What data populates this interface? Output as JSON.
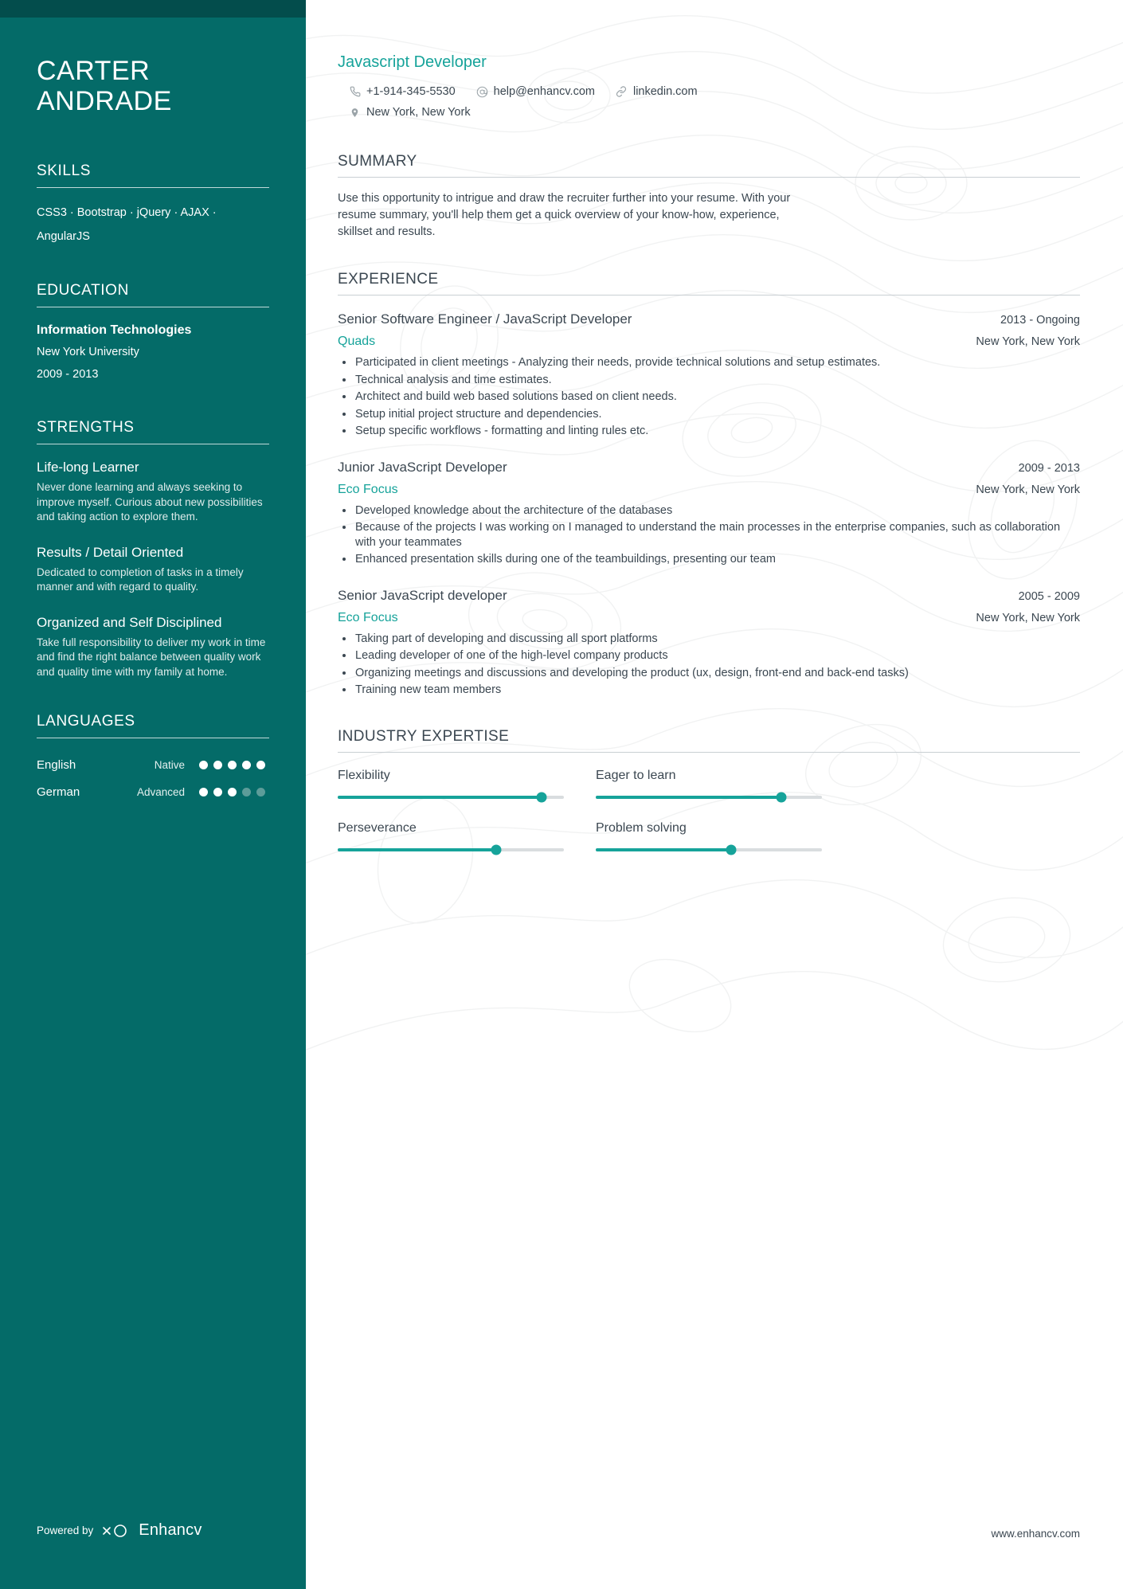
{
  "theme": {
    "sidebar_bg": "#046b68",
    "sidebar_strip": "#034d4c",
    "accent": "#16a39a",
    "text_dark": "#3b4751"
  },
  "sidebar": {
    "name_first": "CARTER",
    "name_last": "ANDRADE",
    "skills": {
      "heading": "SKILLS",
      "text": "CSS3 · Bootstrap · jQuery · AJAX · AngularJS"
    },
    "education": {
      "heading": "EDUCATION",
      "degree": "Information Technologies",
      "school": "New York University",
      "dates": "2009 - 2013"
    },
    "strengths": {
      "heading": "STRENGTHS",
      "items": [
        {
          "title": "Life-long Learner",
          "desc": "Never done learning and always seeking to improve myself. Curious about new possibilities and taking action to explore them."
        },
        {
          "title": "Results / Detail Oriented",
          "desc": "Dedicated to completion of tasks in a timely manner and with regard to quality."
        },
        {
          "title": "Organized and Self Disciplined",
          "desc": "Take full responsibility to deliver my work in time and find the right balance between quality work and quality time with my family at home."
        }
      ]
    },
    "languages": {
      "heading": "LANGUAGES",
      "items": [
        {
          "name": "English",
          "level": "Native",
          "filled": 5,
          "total": 5
        },
        {
          "name": "German",
          "level": "Advanced",
          "filled": 3,
          "total": 5
        }
      ]
    },
    "footer": {
      "powered_by": "Powered by",
      "brand": "Enhancv"
    }
  },
  "main": {
    "role_title": "Javascript Developer",
    "contacts": [
      {
        "icon": "phone-icon",
        "text": "+1-914-345-5530"
      },
      {
        "icon": "email-icon",
        "text": "help@enhancv.com"
      },
      {
        "icon": "link-icon",
        "text": "linkedin.com"
      },
      {
        "icon": "location-icon",
        "text": "New York, New York"
      }
    ],
    "summary": {
      "heading": "SUMMARY",
      "text": "Use this opportunity to intrigue and draw the recruiter further into your resume. With your resume summary, you'll help them get a quick overview of your know-how, experience, skillset and results."
    },
    "experience": {
      "heading": "EXPERIENCE",
      "jobs": [
        {
          "title": "Senior Software Engineer / JavaScript Developer",
          "dates": "2013 - Ongoing",
          "company": "Quads",
          "location": "New York, New York",
          "bullets": [
            "Participated in client meetings - Analyzing their needs, provide technical solutions and setup estimates.",
            "Technical analysis and time estimates.",
            "Architect and build web based solutions based on client needs.",
            "Setup initial project structure and dependencies.",
            "Setup specific workflows - formatting and linting rules etc."
          ]
        },
        {
          "title": "Junior JavaScript Developer",
          "dates": "2009 - 2013",
          "company": "Eco Focus",
          "location": "New York, New York",
          "bullets": [
            "Developed knowledge about the architecture of the databases",
            "Because of the projects I was working on I managed to understand  the main processes in the enterprise companies, such as collaboration  with your teammates",
            "Enhanced presentation skills during one of the teambuildings, presenting our team"
          ]
        },
        {
          "title": "Senior JavaScript developer",
          "dates": "2005 - 2009",
          "company": "Eco Focus",
          "location": "New York, New York",
          "bullets": [
            "Taking part of developing and discussing all sport platforms",
            "Leading developer of one of the high-level company products",
            "Organizing meetings and discussions and developing the product (ux, design, front-end and back-end tasks)",
            "Training new team members"
          ]
        }
      ]
    },
    "industry_expertise": {
      "heading": "INDUSTRY EXPERTISE",
      "items": [
        {
          "label": "Flexibility",
          "percent": 90
        },
        {
          "label": "Eager to learn",
          "percent": 82
        },
        {
          "label": "Perseverance",
          "percent": 70
        },
        {
          "label": "Problem solving",
          "percent": 60
        }
      ]
    },
    "footer_url": "www.enhancv.com"
  }
}
